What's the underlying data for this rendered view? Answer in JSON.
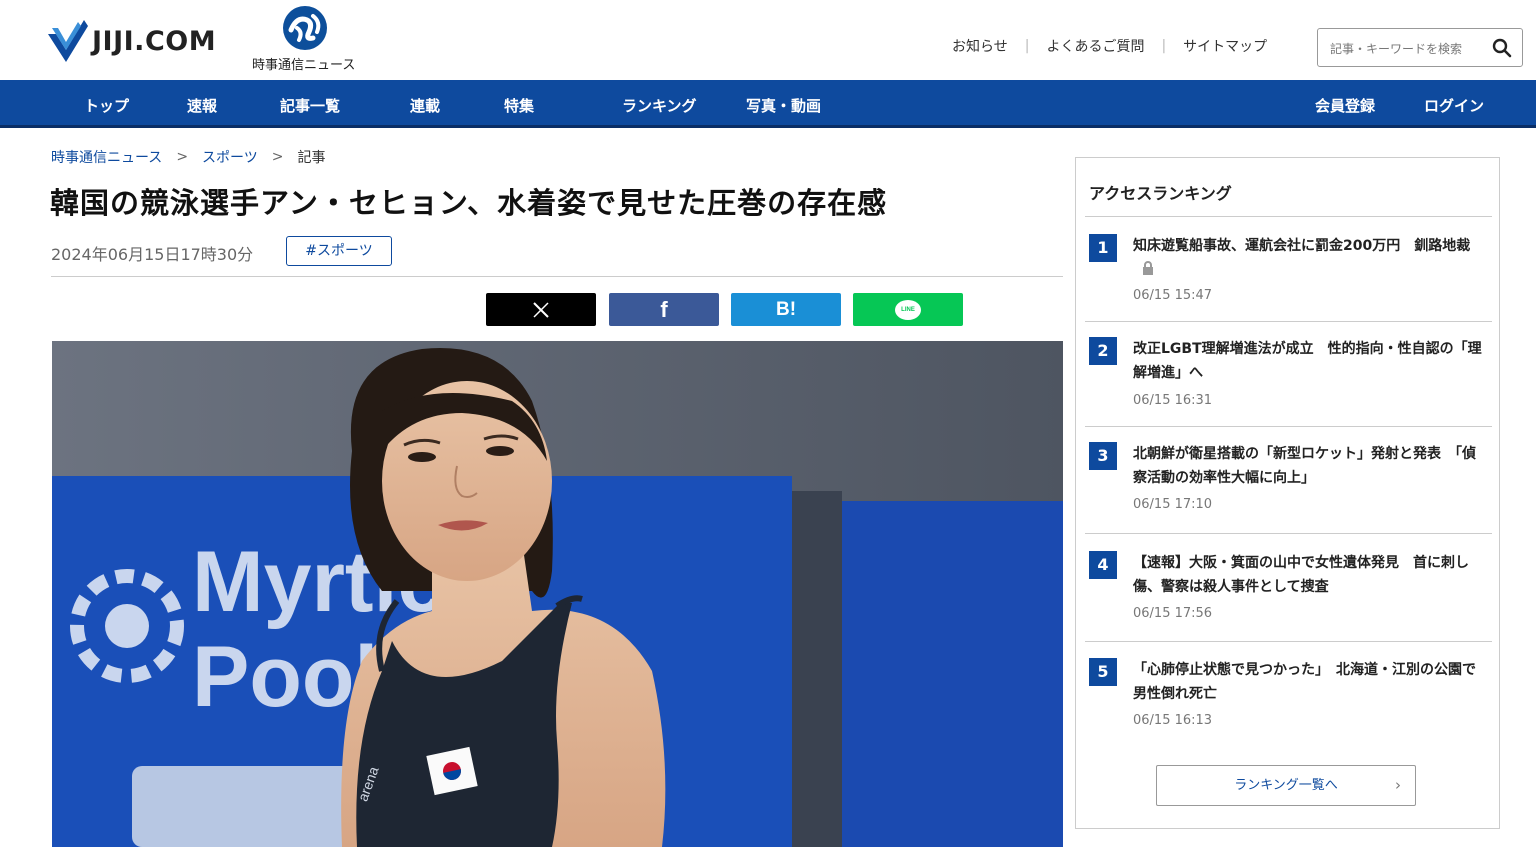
{
  "header": {
    "logo_text": "JIJI.COM",
    "news_label": "時事通信ニュース",
    "top_links": [
      "お知らせ",
      "よくあるご質問",
      "サイトマップ"
    ],
    "search_placeholder": "記事・キーワードを検索"
  },
  "nav": {
    "items": [
      "トップ",
      "速報",
      "記事一覧",
      "連載",
      "特集",
      "ランキング",
      "写真・動画"
    ],
    "right": [
      "会員登録",
      "ログイン"
    ]
  },
  "breadcrumb": [
    "時事通信ニュース",
    "スポーツ",
    "記事"
  ],
  "article": {
    "title": "韓国の競泳選手アン・セヒョン、水着姿で見せた圧巻の存在感",
    "date": "2024年06月15日17時30分",
    "tag": "#スポーツ"
  },
  "share": {
    "x": "X",
    "facebook": "f",
    "hatena": "B!",
    "line": "LINE"
  },
  "photo": {
    "banner_text_1": "Myrtle",
    "banner_text_2": "Pool",
    "suit_brand": "arena"
  },
  "sidebar": {
    "title": "アクセスランキング",
    "items": [
      {
        "rank": "1",
        "title": "知床遊覧船事故、運航会社に罰金200万円　釧路地裁",
        "date": "06/15 15:47"
      },
      {
        "rank": "2",
        "title": "改正LGBT理解増進法が成立　性的指向・性自認の「理解増進」へ",
        "date": "06/15 16:31"
      },
      {
        "rank": "3",
        "title": "北朝鮮が衛星搭載の「新型ロケット」発射と発表　「偵察活動の効率性大幅に向上」",
        "date": "06/15 17:10"
      },
      {
        "rank": "4",
        "title": "【速報】大阪・箕面の山中で女性遺体発見　首に刺し傷、警察は殺人事件として捜査",
        "date": "06/15 17:56"
      },
      {
        "rank": "5",
        "title": "「心肺停止状態で見つかった」　北海道・江別の公園で男性倒れ死亡",
        "date": "06/15 16:13"
      }
    ],
    "more": "ランキング一覧へ"
  },
  "colors": {
    "brand_blue": "#0e4a9e",
    "x": "#000000",
    "facebook": "#3b5998",
    "hatena": "#1a8fd6",
    "line": "#06c755"
  }
}
